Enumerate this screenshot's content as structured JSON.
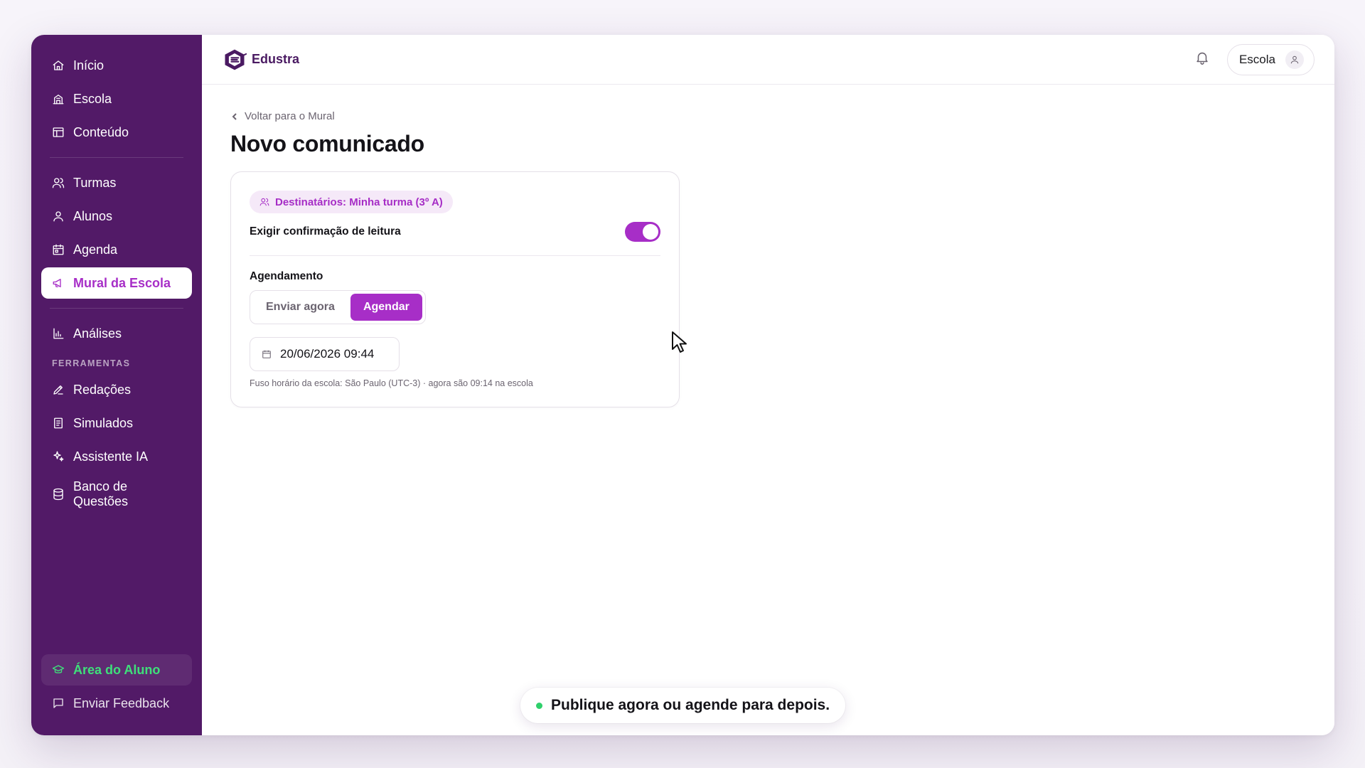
{
  "sidebar": {
    "items_top": [
      {
        "label": "Início",
        "icon": "home-icon"
      },
      {
        "label": "Escola",
        "icon": "school-icon"
      },
      {
        "label": "Conteúdo",
        "icon": "content-icon"
      }
    ],
    "items_mid": [
      {
        "label": "Turmas",
        "icon": "users-icon"
      },
      {
        "label": "Alunos",
        "icon": "user-icon"
      },
      {
        "label": "Agenda",
        "icon": "calendar-icon"
      },
      {
        "label": "Mural da Escola",
        "icon": "megaphone-icon",
        "active": true
      }
    ],
    "items_analytics": [
      {
        "label": "Análises",
        "icon": "bar-chart-icon"
      }
    ],
    "tools_section": "FERRAMENTAS",
    "tools": [
      {
        "label": "Redações",
        "icon": "pencil-icon"
      },
      {
        "label": "Simulados",
        "icon": "clipboard-icon"
      },
      {
        "label": "Assistente IA",
        "icon": "sparkles-icon"
      },
      {
        "label": "Banco de Questões",
        "icon": "database-icon"
      }
    ],
    "student_area": "Área do Aluno",
    "feedback": "Enviar Feedback"
  },
  "topbar": {
    "brand": "Edustra",
    "profile_label": "Escola"
  },
  "page": {
    "back_label": "Voltar para o Mural",
    "title": "Novo comunicado"
  },
  "form": {
    "recipients": "Destinatários: Minha turma (3º A)",
    "read_confirmation_label": "Exigir confirmação de leitura",
    "read_confirmation_on": true,
    "schedule_label": "Agendamento",
    "schedule_options": [
      "Enviar agora",
      "Agendar"
    ],
    "schedule_selected": "Agendar",
    "datetime_value": "20/06/2026 09:44",
    "timezone_hint": "Fuso horário da escola: São Paulo (UTC-3) · agora são 09:14 na escola"
  },
  "toast": {
    "message": "Publique agora ou agende para depois."
  },
  "colors": {
    "sidebar_bg": "#521a67",
    "accent": "#a72ec7",
    "success": "#2fd06b"
  }
}
